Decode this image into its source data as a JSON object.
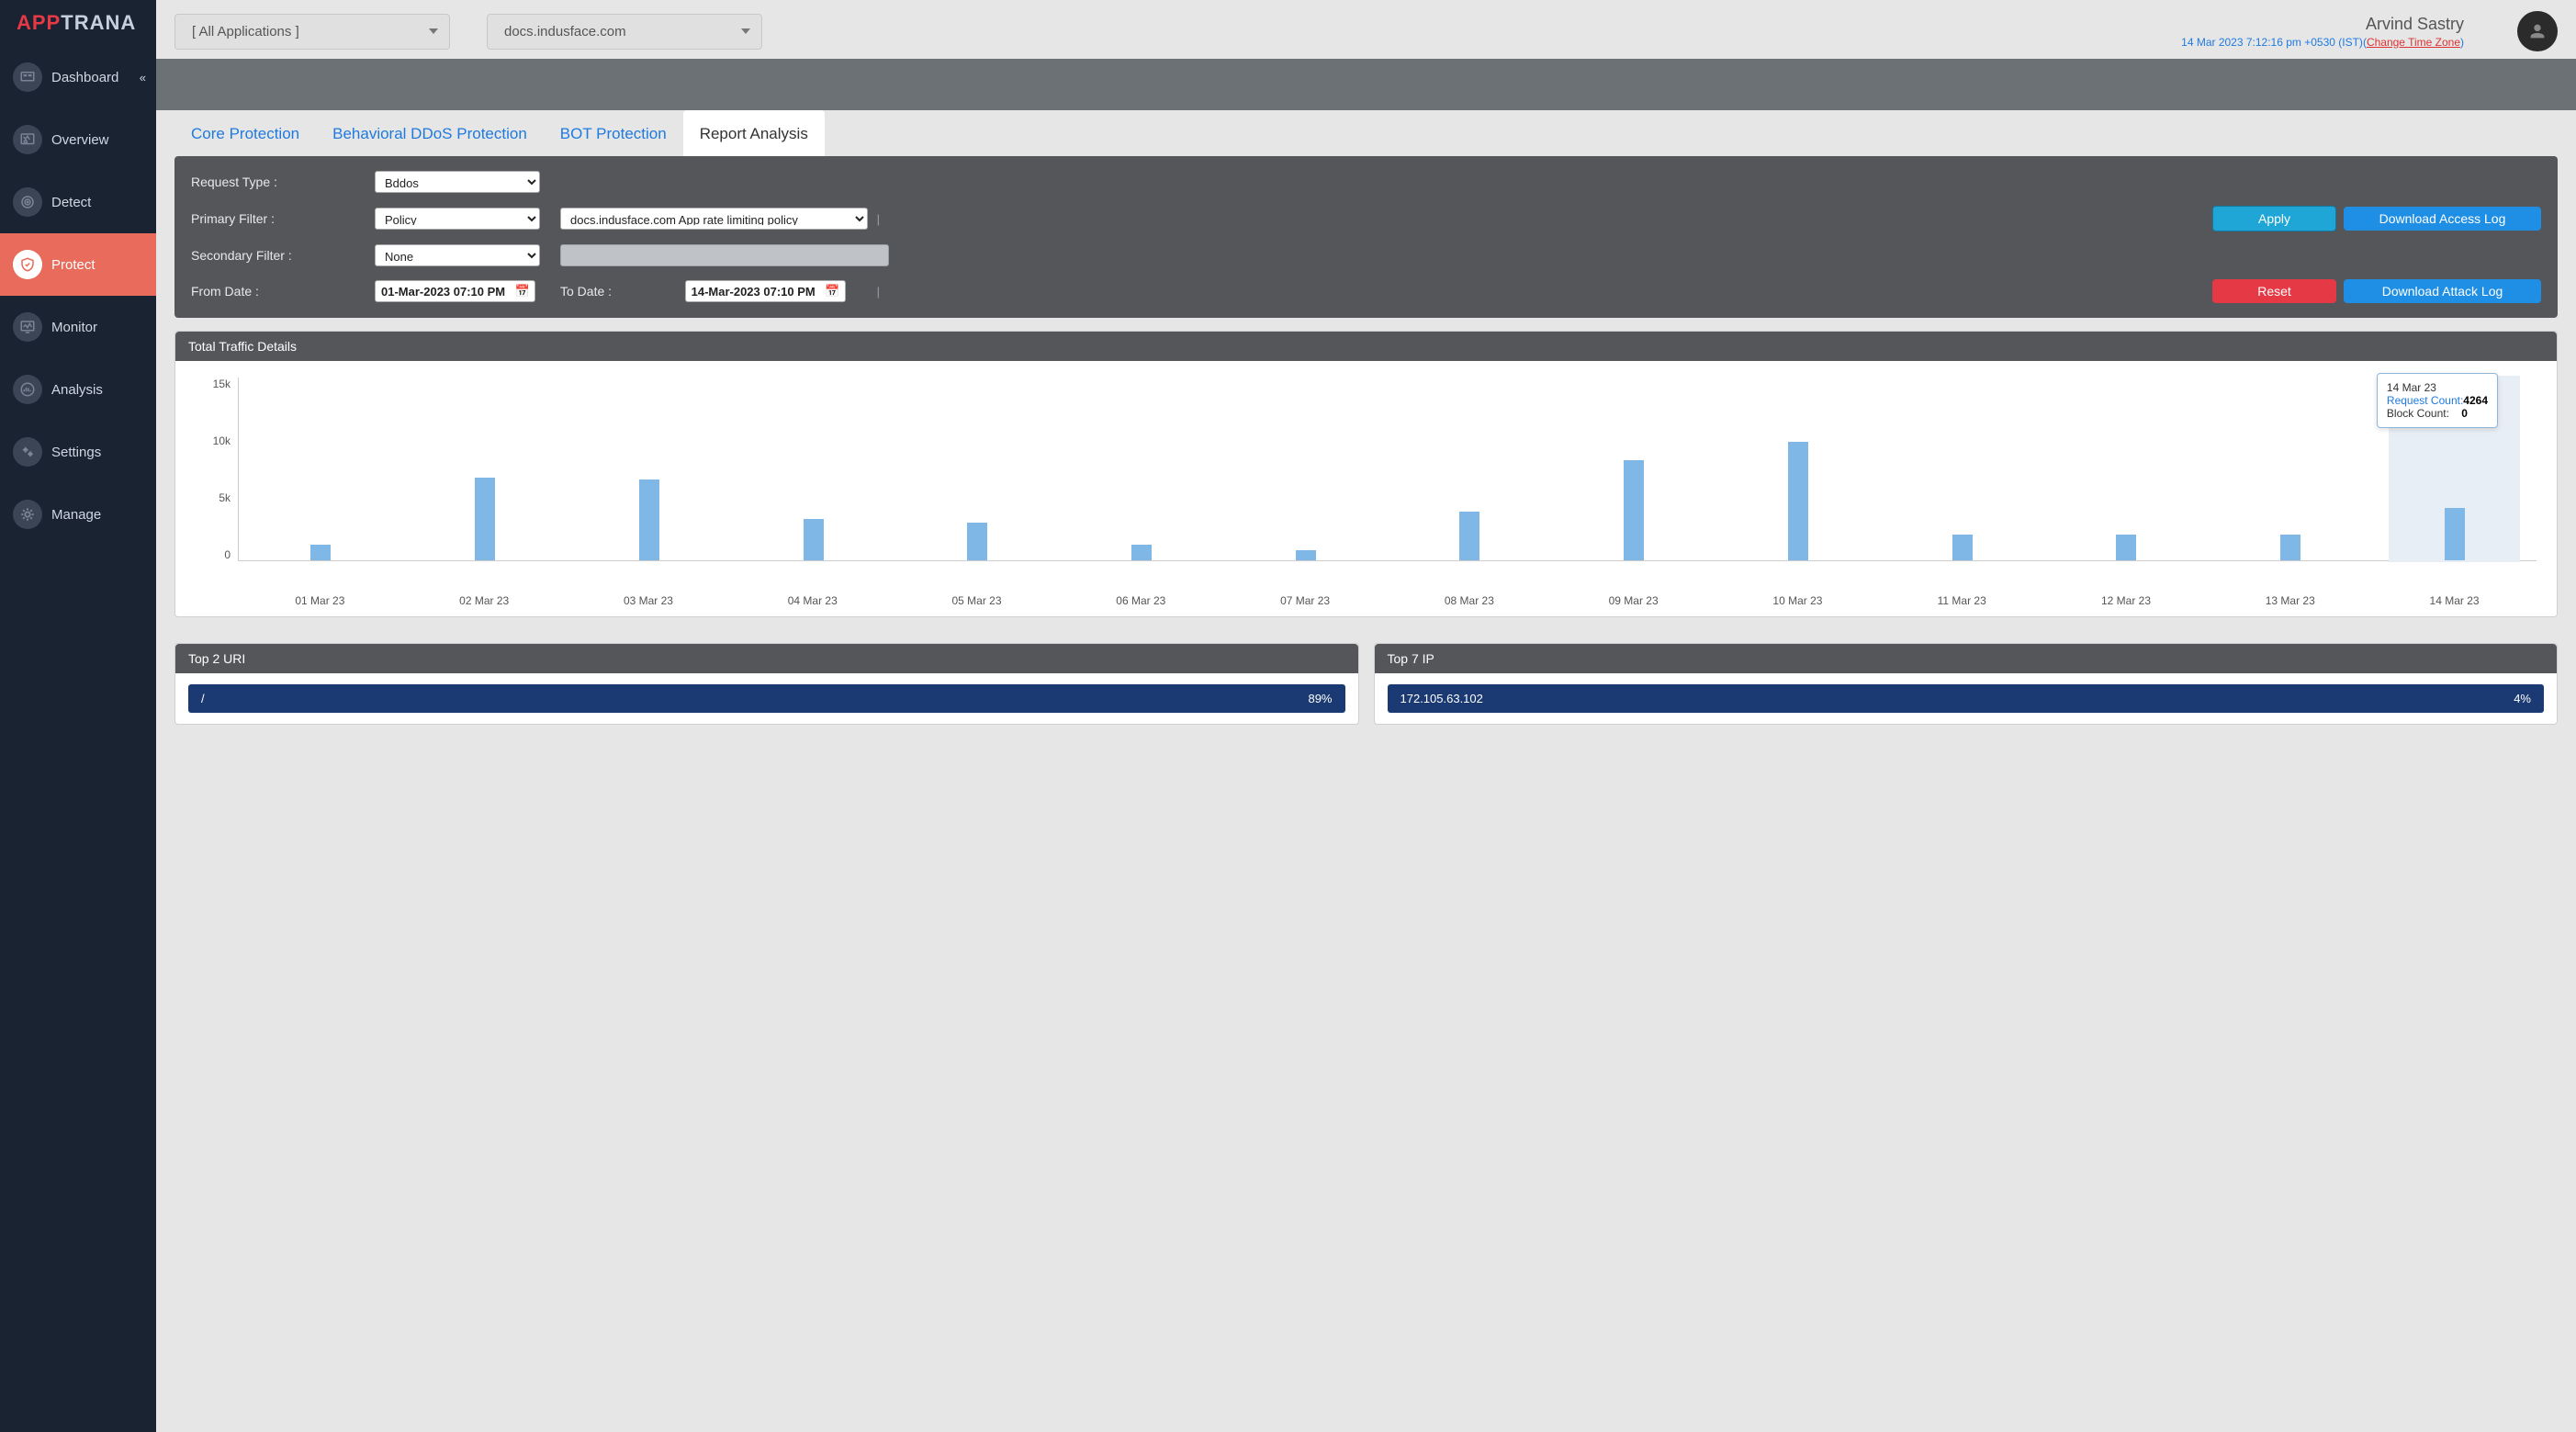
{
  "brand": {
    "part1": "APP",
    "part2": "TRANA"
  },
  "sidebar": {
    "items": [
      {
        "label": "Dashboard",
        "collapse": true
      },
      {
        "label": "Overview"
      },
      {
        "label": "Detect"
      },
      {
        "label": "Protect",
        "active": true
      },
      {
        "label": "Monitor"
      },
      {
        "label": "Analysis"
      },
      {
        "label": "Settings"
      },
      {
        "label": "Manage"
      }
    ]
  },
  "topbar": {
    "app_selector": "[ All Applications ]",
    "domain_selector": "docs.indusface.com",
    "user": "Arvind Sastry",
    "timestamp": "14 Mar 2023 7:12:16 pm +0530 (IST)",
    "tz_link_open": "(",
    "tz_link": "Change Time Zone",
    "tz_link_close": ")"
  },
  "tabs": [
    {
      "label": "Core Protection"
    },
    {
      "label": "Behavioral DDoS Protection"
    },
    {
      "label": "BOT Protection"
    },
    {
      "label": "Report Analysis",
      "active": true
    }
  ],
  "filters": {
    "request_type_label": "Request Type :",
    "request_type_value": "Bddos",
    "primary_filter_label": "Primary Filter :",
    "primary_filter_value": "Policy",
    "primary_filter_app": "docs.indusface.com App rate limiting policy",
    "secondary_filter_label": "Secondary Filter :",
    "secondary_filter_value": "None",
    "from_date_label": "From Date :",
    "from_date_value": "01-Mar-2023 07:10 PM",
    "to_date_label": "To Date :",
    "to_date_value": "14-Mar-2023 07:10 PM",
    "apply": "Apply",
    "download_access": "Download Access Log",
    "reset": "Reset",
    "download_attack": "Download Attack Log"
  },
  "chart_card": {
    "title": "Total Traffic Details"
  },
  "tooltip": {
    "date": "14 Mar 23",
    "req_label": "Request Count:",
    "req_value": "4264",
    "block_label": "Block Count:",
    "block_value": "0"
  },
  "top_uri": {
    "title": "Top 2 URI",
    "rows": [
      {
        "label": "/",
        "value": "89%"
      }
    ]
  },
  "top_ip": {
    "title": "Top 7 IP",
    "rows": [
      {
        "label": "172.105.63.102",
        "value": "4%"
      }
    ]
  },
  "chart_data": {
    "type": "bar",
    "title": "Total Traffic Details",
    "xlabel": "",
    "ylabel": "",
    "ylim": [
      0,
      15000
    ],
    "yticks": [
      "15k",
      "10k",
      "5k",
      "0"
    ],
    "categories": [
      "01 Mar 23",
      "02 Mar 23",
      "03 Mar 23",
      "04 Mar 23",
      "05 Mar 23",
      "06 Mar 23",
      "07 Mar 23",
      "08 Mar 23",
      "09 Mar 23",
      "10 Mar 23",
      "11 Mar 23",
      "12 Mar 23",
      "13 Mar 23",
      "14 Mar 23"
    ],
    "series": [
      {
        "name": "Request Count",
        "values": [
          1300,
          6800,
          6600,
          3400,
          3100,
          1300,
          800,
          4000,
          8200,
          9700,
          2100,
          2100,
          2100,
          4264
        ]
      },
      {
        "name": "Block Count",
        "values": [
          0,
          0,
          0,
          0,
          0,
          0,
          0,
          0,
          0,
          0,
          0,
          0,
          0,
          0
        ]
      }
    ]
  }
}
